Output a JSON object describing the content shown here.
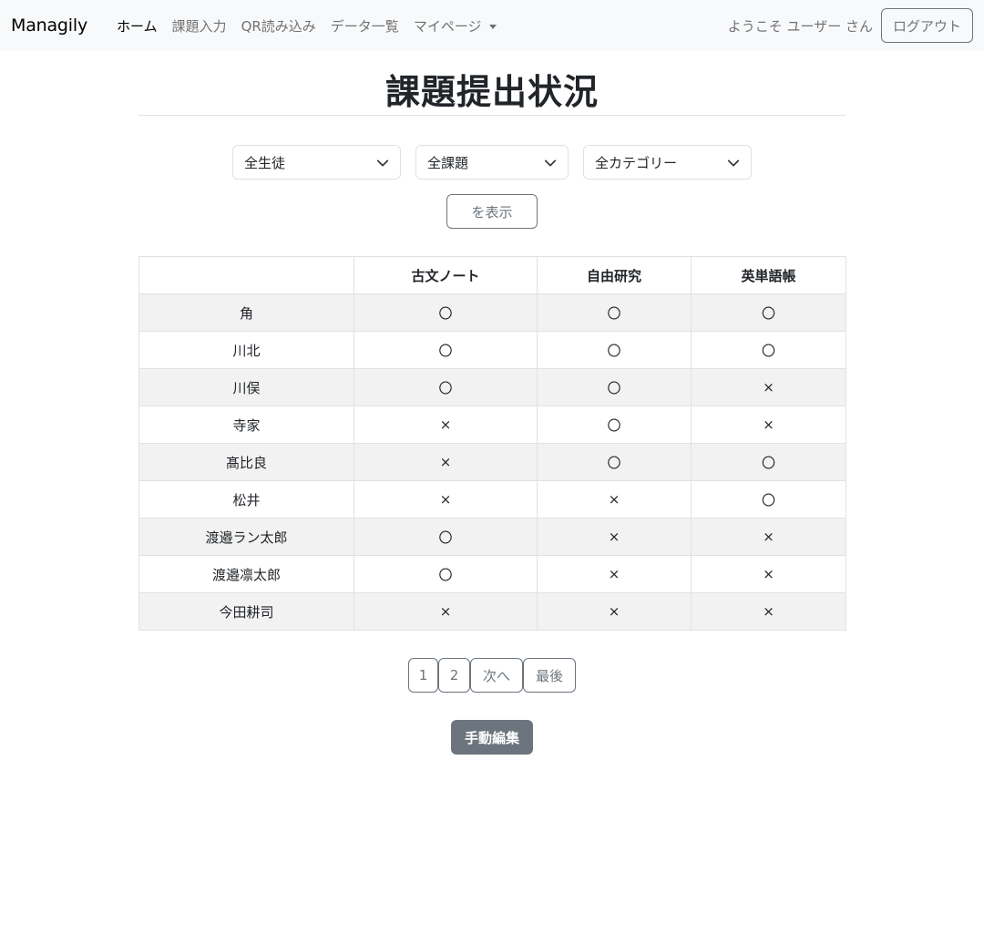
{
  "navbar": {
    "brand": "Managily",
    "links": [
      {
        "label": "ホーム"
      },
      {
        "label": "課題入力"
      },
      {
        "label": "QR読み込み"
      },
      {
        "label": "データ一覧"
      },
      {
        "label": "マイページ"
      }
    ],
    "welcome": "ようこそ ユーザー さん",
    "logout_label": "ログアウト"
  },
  "page": {
    "title": "課題提出状況"
  },
  "filters": {
    "student": "全生徒",
    "assignment": "全課題",
    "category": "全カテゴリー",
    "show_label": "を表示"
  },
  "table": {
    "headers": [
      "",
      "古文ノート",
      "自由研究",
      "英単語帳"
    ],
    "rows": [
      {
        "name": "角",
        "cells": [
          "〇",
          "〇",
          "〇"
        ]
      },
      {
        "name": "川北",
        "cells": [
          "〇",
          "〇",
          "〇"
        ]
      },
      {
        "name": "川俣",
        "cells": [
          "〇",
          "〇",
          "×"
        ]
      },
      {
        "name": "寺家",
        "cells": [
          "×",
          "〇",
          "×"
        ]
      },
      {
        "name": "髙比良",
        "cells": [
          "×",
          "〇",
          "〇"
        ]
      },
      {
        "name": "松井",
        "cells": [
          "×",
          "×",
          "〇"
        ]
      },
      {
        "name": "渡邉ラン太郎",
        "cells": [
          "〇",
          "×",
          "×"
        ]
      },
      {
        "name": "渡邉凛太郎",
        "cells": [
          "〇",
          "×",
          "×"
        ]
      },
      {
        "name": "今田耕司",
        "cells": [
          "×",
          "×",
          "×"
        ]
      }
    ]
  },
  "pagination": {
    "page1": "1",
    "page2": "2",
    "next": "次へ",
    "last": "最後"
  },
  "actions": {
    "manual_edit": "手動編集"
  },
  "icons": {
    "dropdown": "chevron-down-icon",
    "nav_dropdown": "caret-down-icon"
  },
  "colors": {
    "navbar_bg": "#f8f9fa",
    "secondary": "#6c757d",
    "stripe": "#f2f2f2",
    "border": "#dee2e6"
  }
}
